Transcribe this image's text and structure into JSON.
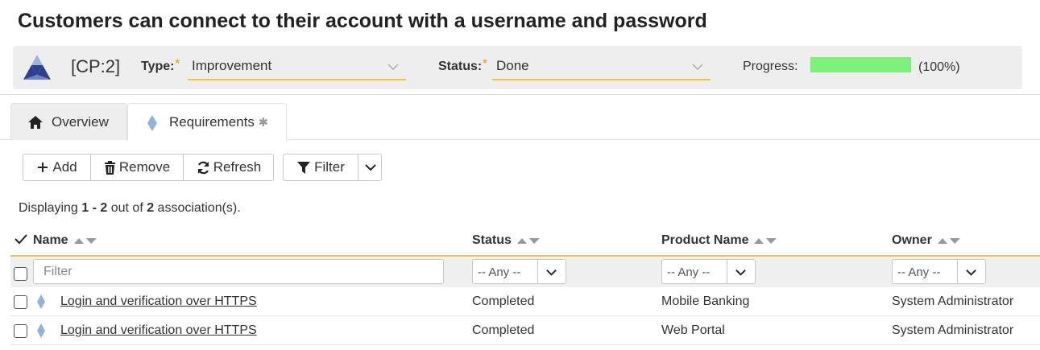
{
  "page": {
    "title": "Customers can connect to their account with a username and password"
  },
  "header": {
    "token": "[CP:2]",
    "type_label": "Type:",
    "type_value": "Improvement",
    "status_label": "Status:",
    "status_value": "Done",
    "required_marker": "*",
    "progress_label": "Progress:",
    "progress_fraction": 1.0,
    "progress_text": "(100%)",
    "progress_color": "#7df07a"
  },
  "tabs": [
    {
      "label": "Overview",
      "icon": "home-icon"
    },
    {
      "label": "Requirements",
      "icon": "diamond-icon",
      "marker": "✱"
    }
  ],
  "toolbar": {
    "add_label": "Add",
    "remove_label": "Remove",
    "refresh_label": "Refresh",
    "filter_label": "Filter"
  },
  "summary": {
    "prefix": "Displaying ",
    "range": "1 - 2",
    "middle": " out of ",
    "total": "2",
    "suffix": " association(s)."
  },
  "table": {
    "columns": [
      "Name",
      "Status",
      "Product Name",
      "Owner"
    ],
    "filter_placeholder": "Filter",
    "any_option": "-- Any --",
    "rows": [
      {
        "name": "Login and verification over HTTPS",
        "status": "Completed",
        "product": "Mobile Banking",
        "owner": "System Administrator"
      },
      {
        "name": "Login and verification over HTTPS",
        "status": "Completed",
        "product": "Web Portal",
        "owner": "System Administrator"
      }
    ]
  },
  "colors": {
    "accent": "#f5c242",
    "required": "#f5a623",
    "requirement_icon": "#8fb3dd"
  }
}
